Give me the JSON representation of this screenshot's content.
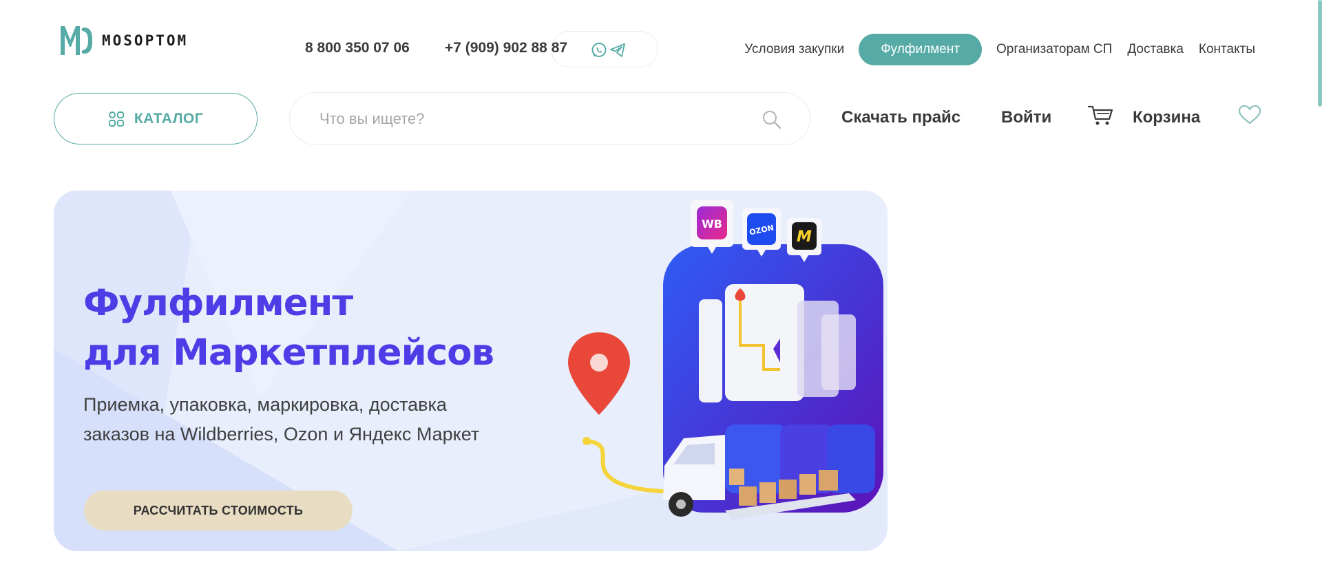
{
  "brand": {
    "logo_text": "MOSOPTOM",
    "accent_color": "#56aba6"
  },
  "header": {
    "phones": [
      "8 800 350 07 06",
      "+7 (909) 902 88 87"
    ],
    "messengers": [
      "whatsapp-icon",
      "telegram-icon"
    ],
    "nav": [
      {
        "label": "Условия закупки",
        "active": false
      },
      {
        "label": "Фулфилмент",
        "active": true
      },
      {
        "label": "Организаторам СП",
        "active": false
      },
      {
        "label": "Доставка",
        "active": false
      },
      {
        "label": "Контакты",
        "active": false
      }
    ]
  },
  "toolbar": {
    "catalog_label": "КАТАЛОГ",
    "search_placeholder": "Что вы ищете?",
    "download_price": "Скачать прайс",
    "login": "Войти",
    "cart": "Корзина"
  },
  "banner": {
    "title_line1": "Фулфилмент",
    "title_line2": "для Маркетплейсов",
    "subtitle_line1": "Приемка, упаковка, маркировка, доставка",
    "subtitle_line2": "заказов на Wildberries, Ozon и Яндекс Маркет",
    "cta": "РАССЧИТАТЬ СТОИМОСТЬ",
    "badges": [
      "WB",
      "OZON",
      "M"
    ],
    "title_color": "#4e3ce6",
    "cta_color": "#e8dcc2"
  }
}
